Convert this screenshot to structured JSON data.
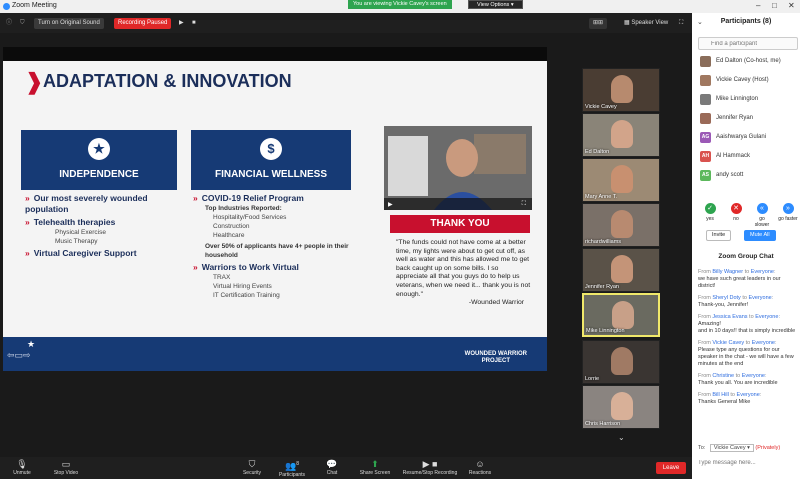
{
  "window": {
    "title": "Zoom Meeting"
  },
  "topbar": {
    "sound_button": "Turn on Original Sound",
    "recording": "Recording Paused",
    "sharing_banner": "You are viewing Vickie Cavey's screen",
    "view_options": "View Options",
    "layout": "Speaker View"
  },
  "slide": {
    "title": "ADAPTATION & INNOVATION",
    "box1": "INDEPENDENCE",
    "box2": "FINANCIAL WELLNESS",
    "col1": {
      "b1": "Our most severely wounded population",
      "b2": "Telehealth therapies",
      "b2_subs": [
        "Physical Exercise",
        "Music Therapy"
      ],
      "b3": "Virtual Caregiver Support"
    },
    "col2": {
      "b1": "COVID-19 Relief Program",
      "top_label": "Top Industries Reported:",
      "industries": [
        "Hospitality/Food Services",
        "Construction",
        "Healthcare"
      ],
      "stat": "Over 50% of applicants have 4+ people in their household",
      "b2": "Warriors to Work Virtual",
      "b2_subs": [
        "TRAX",
        "Virtual Hiring Events",
        "IT Certification Training"
      ]
    },
    "thankyou": "THANK YOU",
    "quote": "\"The funds could not have come at a better time, my lights were about to get cut off, as well as water and this has allowed me to get back caught up on some bills. I so appreciate all that you guys do to help us veterans, when we need it... thank you is not enough.\"",
    "quote_author": "-Wounded Warrior",
    "footer_logo_line1": "WOUNDED WARRIOR",
    "footer_logo_line2": "PROJECT"
  },
  "gallery": [
    {
      "name": "Vickie Cavey"
    },
    {
      "name": "Ed Dalton"
    },
    {
      "name": "Mary Anne T."
    },
    {
      "name": "richardwilliams"
    },
    {
      "name": "Jennifer Ryan"
    },
    {
      "name": "Mike Linnington"
    },
    {
      "name": "Lorrie"
    },
    {
      "name": "Chris Harrison"
    }
  ],
  "participants": {
    "header": "Participants (8)",
    "find_placeholder": "Find a participant",
    "list": [
      {
        "initials": "",
        "name": "Ed Dalton (Co-host, me)",
        "color": "#8a6d5a"
      },
      {
        "initials": "",
        "name": "Vickie Cavey (Host)",
        "color": "#a07860"
      },
      {
        "initials": "",
        "name": "Mike Linnington",
        "color": "#7a7a7a"
      },
      {
        "initials": "",
        "name": "Jennifer Ryan",
        "color": "#9a6a58"
      },
      {
        "initials": "AG",
        "name": "Aaishwarya Gulani",
        "color": "#9b59b6"
      },
      {
        "initials": "AH",
        "name": "Al Hammack",
        "color": "#d9534f"
      },
      {
        "initials": "AS",
        "name": "andy scott",
        "color": "#5cb85c"
      }
    ],
    "reactions": [
      {
        "label": "yes",
        "sym": "✓",
        "color": "#2ea44f"
      },
      {
        "label": "no",
        "sym": "✕",
        "color": "#e02828"
      },
      {
        "label": "go slower",
        "sym": "«",
        "color": "#2d8cff"
      },
      {
        "label": "go faster",
        "sym": "»",
        "color": "#2d8cff"
      }
    ],
    "invite": "Invite",
    "mute_all": "Mute All"
  },
  "chat": {
    "header": "Zoom Group Chat",
    "messages": [
      {
        "from": "Billy Wagner",
        "to": "Everyone",
        "text": "we have such great leaders in our district!"
      },
      {
        "from": "Sheryl Doty",
        "to": "Everyone",
        "text": "Thank-you, Jennifer!"
      },
      {
        "from": "Jessica Evans",
        "to": "Everyone",
        "text": "Amazing!\nand in 10 days!! that is simply incredible"
      },
      {
        "from": "Vickie Cavey",
        "to": "Everyone",
        "text": "Please type any questions for our speaker in the chat - we will have a few minutes at the end"
      },
      {
        "from": "Christine",
        "to": "Everyone",
        "text": "Thank you all. You are incredible"
      },
      {
        "from": "Bill Hill",
        "to": "Everyone",
        "text": "Thanks General Mike"
      }
    ],
    "to_label": "To:",
    "to_value": "Vickie Cavey",
    "privately": "(Privately)",
    "input_placeholder": "Type message here..."
  },
  "bottombar": {
    "unmute": "Unmute",
    "stop_video": "Stop Video",
    "security": "Security",
    "participants": "Participants",
    "participants_count": "8",
    "chat": "Chat",
    "share_screen": "Share Screen",
    "recording": "Resume/Stop Recording",
    "reactions": "Reactions",
    "leave": "Leave"
  }
}
